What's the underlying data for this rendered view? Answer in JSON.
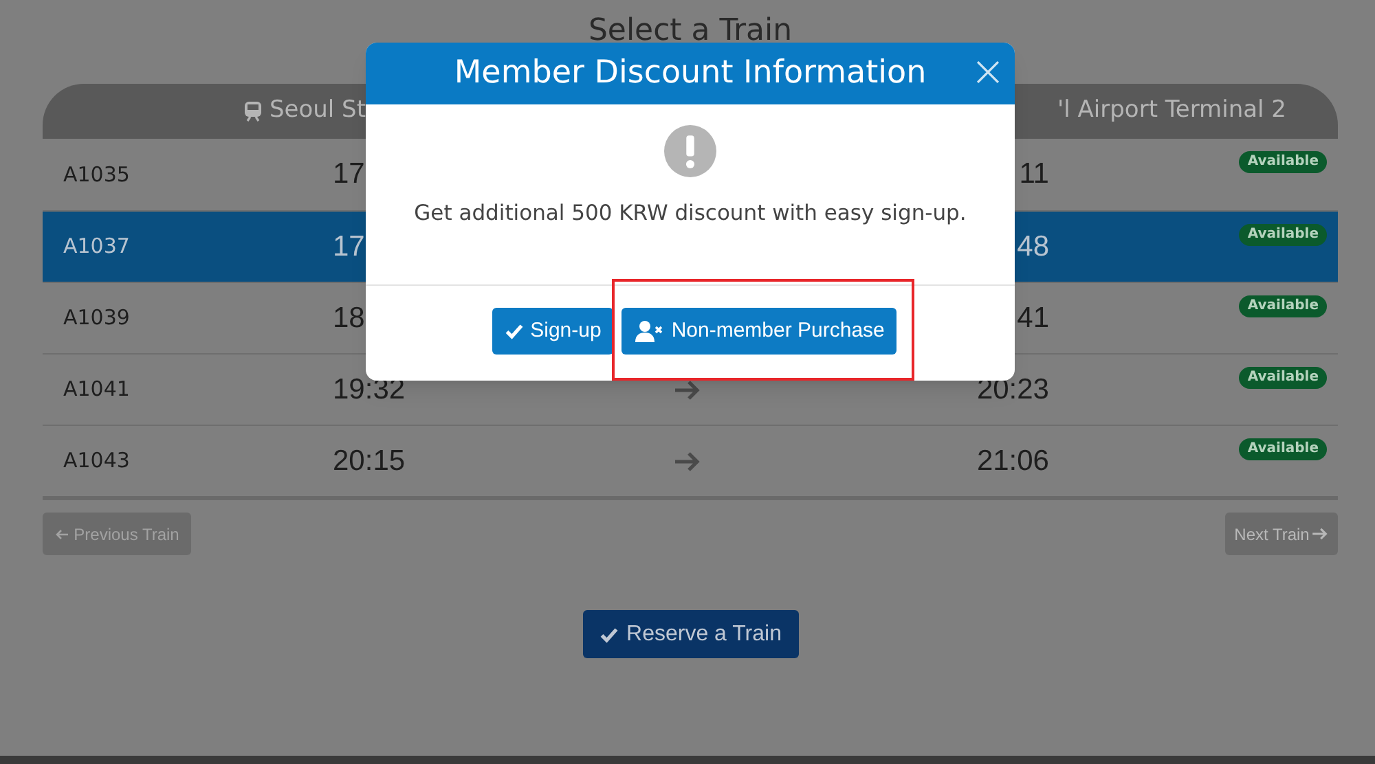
{
  "page_title": "Select a Train",
  "table": {
    "columns": [
      {
        "text": "Seoul St"
      },
      {
        "text": "'l Airport Terminal 2"
      }
    ],
    "rows": [
      {
        "train": "A1035",
        "departure": "17",
        "arrow": false,
        "arrival": "11",
        "status": "Available",
        "selected": false
      },
      {
        "train": "A1037",
        "departure": "17",
        "arrow": false,
        "arrival": "48",
        "status": "Available",
        "selected": true
      },
      {
        "train": "A1039",
        "departure": "18",
        "arrow": false,
        "arrival": "41",
        "status": "Available",
        "selected": false
      },
      {
        "train": "A1041",
        "departure": "19:32",
        "arrow": true,
        "arrival": "20:23",
        "status": "Available",
        "selected": false
      },
      {
        "train": "A1043",
        "departure": "20:15",
        "arrow": true,
        "arrival": "21:06",
        "status": "Available",
        "selected": false
      }
    ]
  },
  "pagination": {
    "previous": {
      "label": "Previous Train",
      "disabled": true
    },
    "next": {
      "label": "Next Train",
      "disabled": false
    }
  },
  "reserve_button": "Reserve a Train",
  "modal": {
    "title": "Member Discount Information",
    "message": "Get additional 500 KRW discount with easy sign-up.",
    "buttons": [
      {
        "kind": "signup",
        "label": "Sign-up",
        "highlighted": false
      },
      {
        "kind": "guest",
        "label": "Non-member Purchase",
        "highlighted": true
      }
    ]
  }
}
